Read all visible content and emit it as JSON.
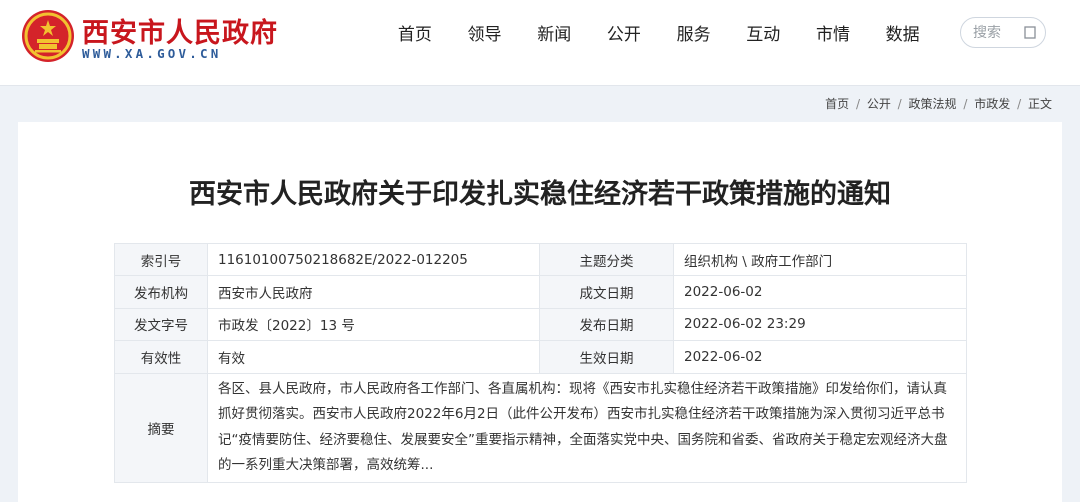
{
  "site": {
    "name": "西安市人民政府",
    "domain": "WWW.XA.GOV.CN",
    "brand_color": "#c8161d",
    "domain_color": "#2e5c9a"
  },
  "nav": [
    "首页",
    "领导",
    "新闻",
    "公开",
    "服务",
    "互动",
    "市情",
    "数据"
  ],
  "search": {
    "placeholder": "搜索",
    "icon": "search-icon"
  },
  "breadcrumb": {
    "items": [
      "首页",
      "公开",
      "政策法规",
      "市政发"
    ],
    "current": "正文",
    "separator": "/"
  },
  "article": {
    "title": "西安市人民政府关于印发扎实稳住经济若干政策措施的通知"
  },
  "meta": {
    "index_label": "索引号",
    "index_value": "11610100750218682E/2022-012205",
    "topic_label": "主题分类",
    "topic_value": "组织机构 \\ 政府工作部门",
    "publisher_label": "发布机构",
    "publisher_value": "西安市人民政府",
    "created_label": "成文日期",
    "created_value": "2022-06-02",
    "docno_label": "发文字号",
    "docno_value": "市政发〔2022〕13 号",
    "published_label": "发布日期",
    "published_value": "2022-06-02 23:29",
    "valid_label": "有效性",
    "valid_value": "有效",
    "effective_label": "生效日期",
    "effective_value": "2022-06-02",
    "summary_label": "摘要",
    "summary_value": "各区、县人民政府，市人民政府各工作部门、各直属机构：现将《西安市扎实稳住经济若干政策措施》印发给你们，请认真抓好贯彻落实。西安市人民政府2022年6月2日（此件公开发布）西安市扎实稳住经济若干政策措施为深入贯彻习近平总书记“疫情要防住、经济要稳住、发展要安全”重要指示精神，全面落实党中央、国务院和省委、省政府关于稳定宏观经济大盘的一系列重大决策部署，高效统筹..."
  }
}
